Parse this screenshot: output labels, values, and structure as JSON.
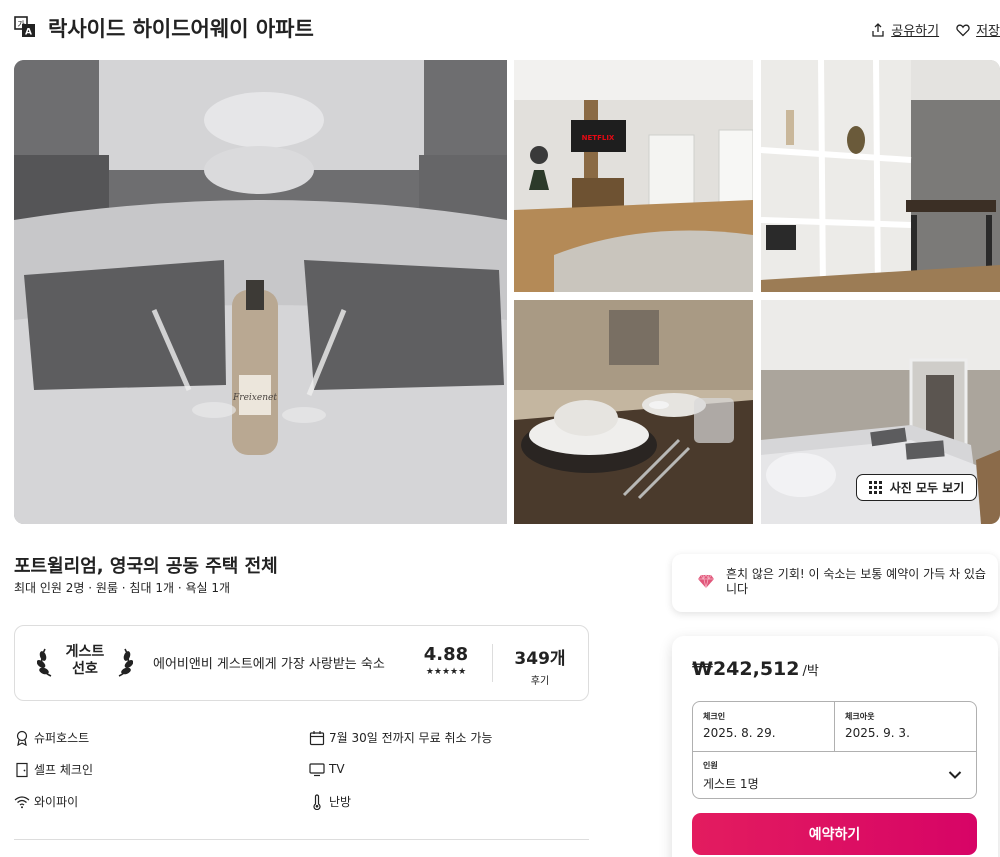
{
  "header": {
    "title": "락사이드 하이드어웨이 아파트",
    "share_label": "공유하기",
    "save_label": "저장"
  },
  "photos": {
    "show_all_label": "사진 모두 보기",
    "main_bottle_label": "Freixenet",
    "tv_label": "NETFLIX"
  },
  "listing": {
    "title": "포트윌리엄, 영국의 공동 주택 전체",
    "subtitle": "최대 인원 2명 · 원룸 · 침대 1개 · 욕실 1개"
  },
  "guest_favorite": {
    "badge_line1": "게스트",
    "badge_line2": "선호",
    "description": "에어비앤비 게스트에게 가장 사랑받는 숙소",
    "rating": "4.88",
    "stars": "★★★★★",
    "review_count": "349개",
    "review_label": "후기"
  },
  "amenities": [
    {
      "icon": "superhost-icon",
      "label": "슈퍼호스트"
    },
    {
      "icon": "calendar-icon",
      "label": "7월 30일 전까지 무료 취소 가능"
    },
    {
      "icon": "door-icon",
      "label": "셀프 체크인"
    },
    {
      "icon": "tv-icon",
      "label": "TV"
    },
    {
      "icon": "wifi-icon",
      "label": "와이파이"
    },
    {
      "icon": "thermometer-icon",
      "label": "난방"
    }
  ],
  "rare_find": {
    "icon": "gem-icon",
    "text": "흔치 않은 기회! 이 숙소는 보통 예약이 가득 차 있습니다"
  },
  "booking": {
    "price": "₩242,512",
    "per_night": "/박",
    "checkin_label": "체크인",
    "checkin_value": "2025. 8. 29.",
    "checkout_label": "체크아웃",
    "checkout_value": "2025. 9. 3.",
    "guests_label": "인원",
    "guests_value": "게스트 1명",
    "reserve_label": "예약하기"
  },
  "colors": {
    "accent": "#e31c5f",
    "text": "#222222",
    "border": "#dddddd",
    "gem": "#e0567a"
  }
}
